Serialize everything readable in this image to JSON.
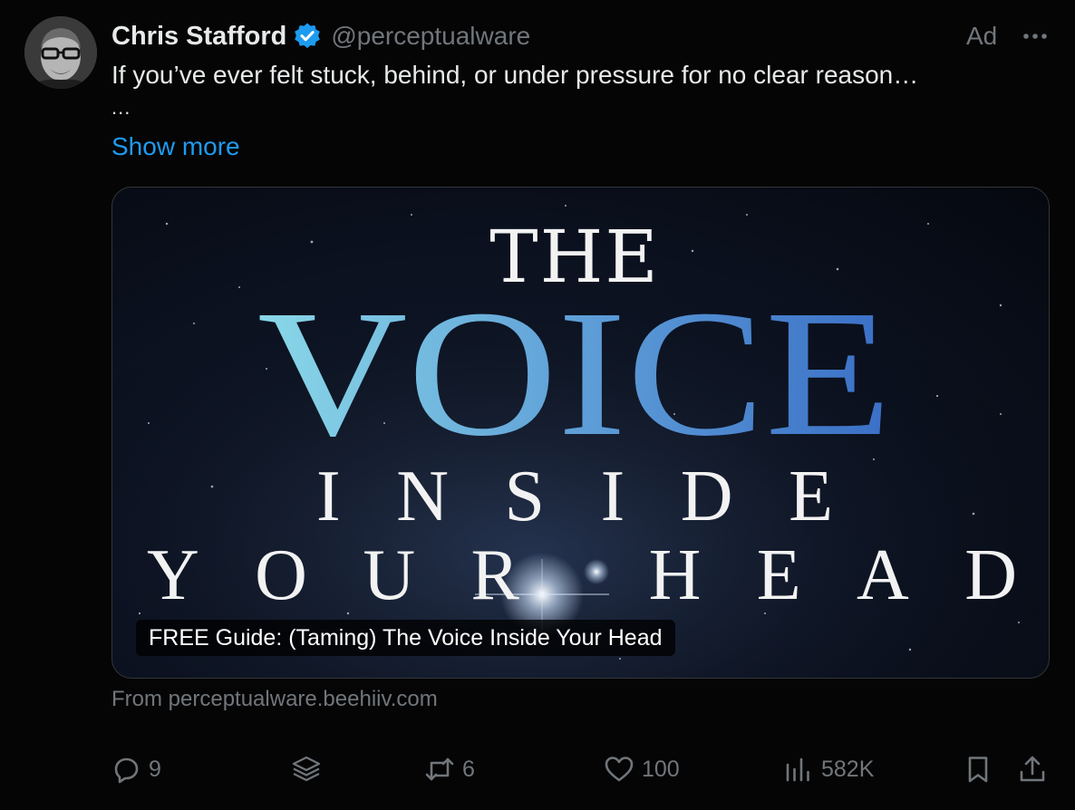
{
  "post": {
    "author_name": "Chris Stafford",
    "handle": "@perceptualware",
    "ad_label": "Ad",
    "text": "If you’ve ever felt stuck, behind, or under pressure for no clear reason…",
    "ellipsis": "...",
    "show_more": "Show more"
  },
  "media": {
    "title_line1": "THE",
    "title_line2": "VOICE",
    "title_line3": "INSIDE",
    "title_line4": "YOUR HEAD",
    "caption": "FREE Guide: (Taming) The Voice Inside Your Head",
    "source": "From perceptualware.beehiiv.com"
  },
  "actions": {
    "replies": "9",
    "reposts": "6",
    "likes": "100",
    "views": "582K"
  },
  "colors": {
    "background": "#000000",
    "link": "#1d9bf0",
    "muted": "#71767b",
    "verified": "#1d9bf0",
    "voice_gradient_start": "#8ad8e8",
    "voice_gradient_end": "#3a6fc6"
  },
  "icons": {
    "verified": "verified-badge-icon",
    "more": "more-dots-icon",
    "reply": "reply-icon",
    "grok": "grok-icon",
    "repost": "repost-icon",
    "like": "heart-icon",
    "views": "views-icon",
    "bookmark": "bookmark-icon",
    "share": "share-icon"
  }
}
